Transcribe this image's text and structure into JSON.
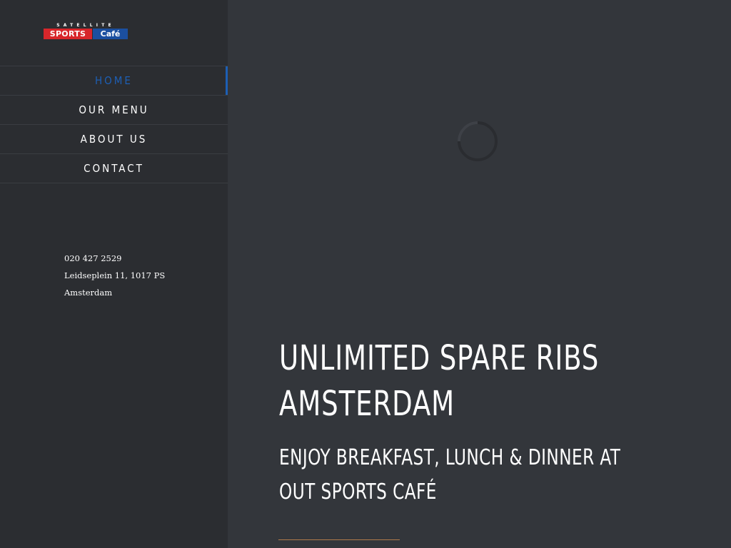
{
  "logo": {
    "top_text": "SATELLITE",
    "sports_text": "SPORTS",
    "cafe_text": "Café",
    "sports_color": "#d8262b",
    "cafe_color": "#1b4fa0"
  },
  "nav": {
    "items": [
      {
        "label": "HOME",
        "active": true
      },
      {
        "label": "OUR MENU",
        "active": false
      },
      {
        "label": "ABOUT US",
        "active": false
      },
      {
        "label": "CONTACT",
        "active": false
      }
    ],
    "active_color": "#1d5fb5"
  },
  "contact": {
    "phone": "020 427 2529",
    "address_line1": "Leidseplein 11, 1017 PS",
    "address_line2": "Amsterdam"
  },
  "hero": {
    "title_line1": "UNLIMITED SPARE RIBS",
    "title_line2": "AMSTERDAM",
    "subtitle_line1": "ENJOY BREAKFAST, LUNCH & DINNER AT",
    "subtitle_line2": "OUT SPORTS CAFÉ"
  },
  "colors": {
    "sidebar_bg": "#2b2d31",
    "main_bg": "#33363b",
    "divider": "#b07a4a"
  },
  "icons": {
    "spinner": "loading-spinner-icon"
  }
}
